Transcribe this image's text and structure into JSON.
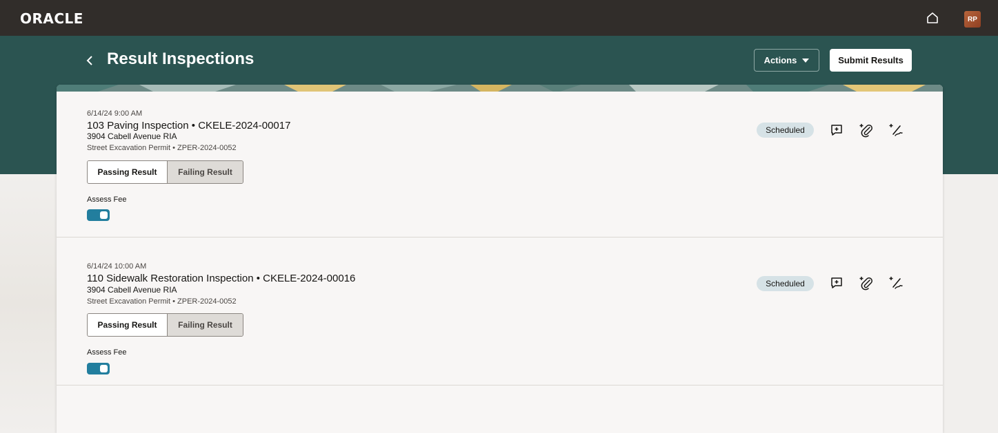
{
  "app": {
    "logo": "ORACLE",
    "avatar_initials": "RP",
    "home_icon": "home-icon"
  },
  "header": {
    "title": "Result Inspections",
    "actions_label": "Actions",
    "submit_label": "Submit Results"
  },
  "inspections": [
    {
      "date": "6/14/24 9:00 AM",
      "title": "103 Paving Inspection • CKELE-2024-00017",
      "address": "3904 Cabell Avenue RIA",
      "permit": "Street Excavation Permit • ZPER-2024-0052",
      "status": "Scheduled",
      "passing_label": "Passing Result",
      "failing_label": "Failing Result",
      "fee_label": "Assess Fee",
      "fee_on": true
    },
    {
      "date": "6/14/24 10:00 AM",
      "title": "110 Sidewalk Restoration Inspection • CKELE-2024-00016",
      "address": "3904 Cabell Avenue RIA",
      "permit": "Street Excavation Permit • ZPER-2024-0052",
      "status": "Scheduled",
      "passing_label": "Passing Result",
      "failing_label": "Failing Result",
      "fee_label": "Assess Fee",
      "fee_on": true
    }
  ],
  "colors": {
    "topbar": "#312d2a",
    "header_band": "#2b5451",
    "toggle_on": "#227e9e",
    "status_badge": "#d6e2e6"
  }
}
